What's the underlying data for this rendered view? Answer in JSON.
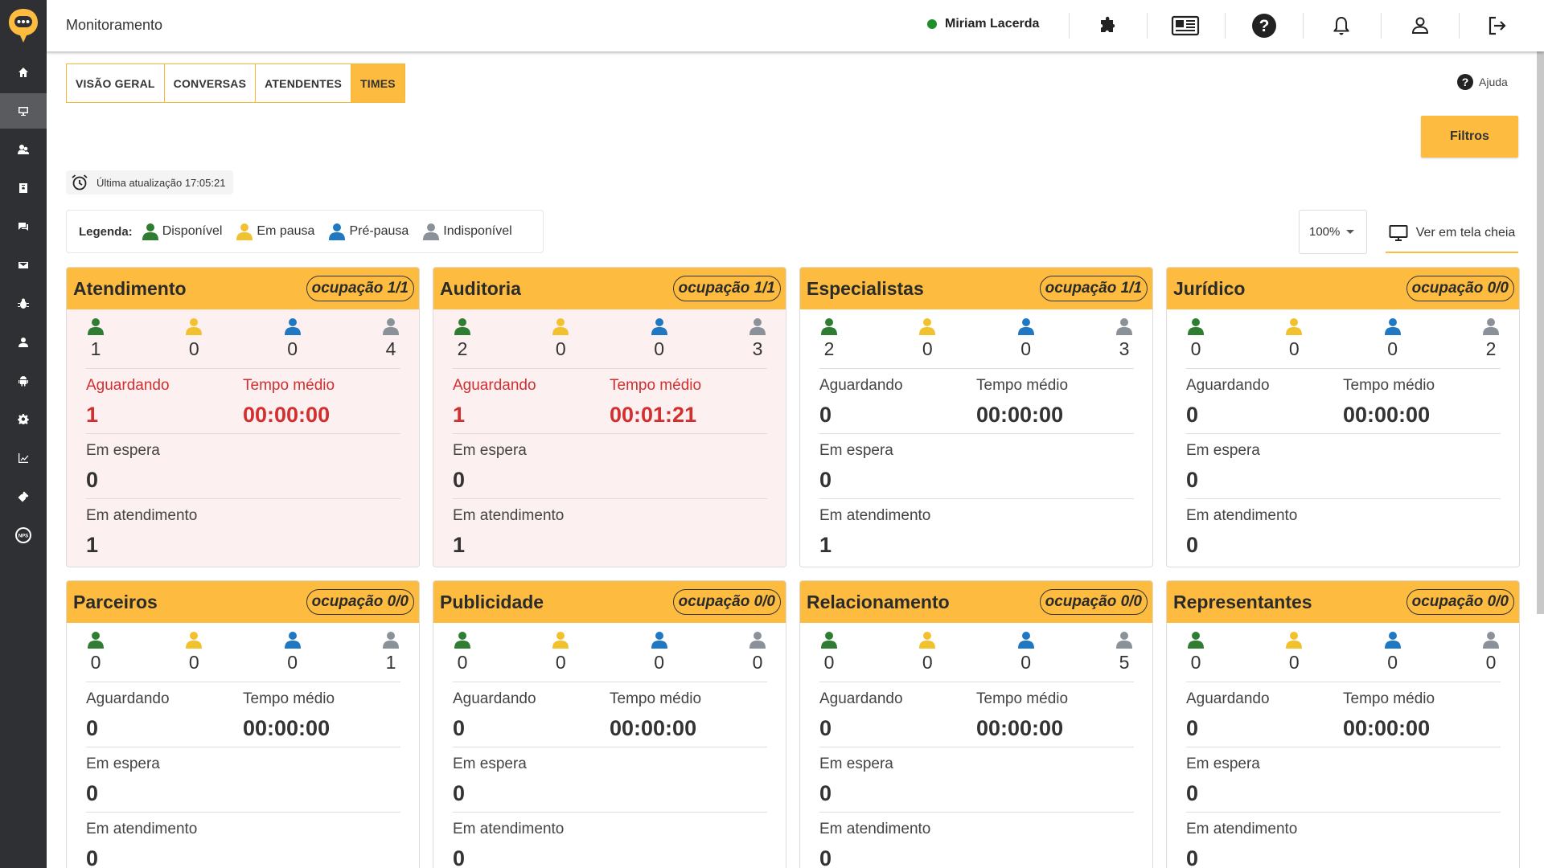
{
  "header": {
    "title": "Monitoramento",
    "user_name": "Miriam Lacerda"
  },
  "tabs": [
    {
      "label": "VISÃO GERAL",
      "active": false
    },
    {
      "label": "CONVERSAS",
      "active": false
    },
    {
      "label": "ATENDENTES",
      "active": false
    },
    {
      "label": "TIMES",
      "active": true
    }
  ],
  "help_label": "Ajuda",
  "filters_label": "Filtros",
  "last_update": "Última atualização 17:05:21",
  "legend": {
    "label": "Legenda:",
    "items": [
      {
        "label": "Disponível",
        "color": "#2e7d32"
      },
      {
        "label": "Em pausa",
        "color": "#f2c12e"
      },
      {
        "label": "Pré-pausa",
        "color": "#1f78c1"
      },
      {
        "label": "Indisponível",
        "color": "#8a9199"
      }
    ]
  },
  "zoom_value": "100%",
  "fullscreen_label": "Ver em tela cheia",
  "metric_labels": {
    "waiting": "Aguardando",
    "avg_time": "Tempo médio",
    "on_hold": "Em espera",
    "in_service": "Em atendimento"
  },
  "teams": [
    {
      "name": "Atendimento",
      "occupancy": "ocupação 1/1",
      "alert": true,
      "counts": [
        "1",
        "0",
        "0",
        "4"
      ],
      "waiting": "1",
      "avg_time": "00:00:00",
      "on_hold": "0",
      "in_service": "1"
    },
    {
      "name": "Auditoria",
      "occupancy": "ocupação 1/1",
      "alert": true,
      "counts": [
        "2",
        "0",
        "0",
        "3"
      ],
      "waiting": "1",
      "avg_time": "00:01:21",
      "on_hold": "0",
      "in_service": "1"
    },
    {
      "name": "Especialistas",
      "occupancy": "ocupação 1/1",
      "alert": false,
      "counts": [
        "2",
        "0",
        "0",
        "3"
      ],
      "waiting": "0",
      "avg_time": "00:00:00",
      "on_hold": "0",
      "in_service": "1"
    },
    {
      "name": "Jurídico",
      "occupancy": "ocupação 0/0",
      "alert": false,
      "counts": [
        "0",
        "0",
        "0",
        "2"
      ],
      "waiting": "0",
      "avg_time": "00:00:00",
      "on_hold": "0",
      "in_service": "0"
    },
    {
      "name": "Parceiros",
      "occupancy": "ocupação 0/0",
      "alert": false,
      "counts": [
        "0",
        "0",
        "0",
        "1"
      ],
      "waiting": "0",
      "avg_time": "00:00:00",
      "on_hold": "0",
      "in_service": "0"
    },
    {
      "name": "Publicidade",
      "occupancy": "ocupação 0/0",
      "alert": false,
      "counts": [
        "0",
        "0",
        "0",
        "0"
      ],
      "waiting": "0",
      "avg_time": "00:00:00",
      "on_hold": "0",
      "in_service": "0"
    },
    {
      "name": "Relacionamento",
      "occupancy": "ocupação 0/0",
      "alert": false,
      "counts": [
        "0",
        "0",
        "0",
        "5"
      ],
      "waiting": "0",
      "avg_time": "00:00:00",
      "on_hold": "0",
      "in_service": "0"
    },
    {
      "name": "Representantes",
      "occupancy": "ocupação 0/0",
      "alert": false,
      "counts": [
        "0",
        "0",
        "0",
        "0"
      ],
      "waiting": "0",
      "avg_time": "00:00:00",
      "on_hold": "0",
      "in_service": "0"
    }
  ]
}
